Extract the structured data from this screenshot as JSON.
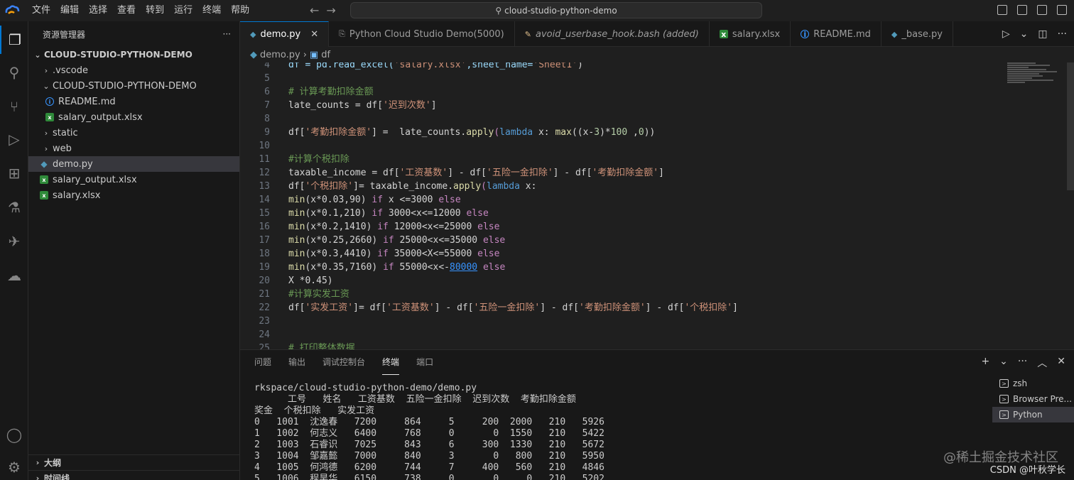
{
  "menu": [
    "文件",
    "编辑",
    "选择",
    "查看",
    "转到",
    "运行",
    "终端",
    "帮助"
  ],
  "command_center": "cloud-studio-python-demo",
  "sidebar": {
    "title": "资源管理器",
    "more": "···",
    "root": "CLOUD-STUDIO-PYTHON-DEMO",
    "items": [
      {
        "label": ".vscode"
      },
      {
        "label": "CLOUD-STUDIO-PYTHON-DEMO"
      },
      {
        "label": "README.md"
      },
      {
        "label": "salary_output.xlsx"
      },
      {
        "label": "static"
      },
      {
        "label": "web"
      },
      {
        "label": "demo.py"
      },
      {
        "label": "salary_output.xlsx"
      },
      {
        "label": "salary.xlsx"
      }
    ],
    "outline": "大纲",
    "timeline": "时间线"
  },
  "tabs": [
    {
      "label": "demo.py",
      "icon": "python-icon"
    },
    {
      "label": "Python Cloud Studio Demo(5000)",
      "icon": "browser-icon"
    },
    {
      "label": "avoid_userbase_hook.bash (added)",
      "icon": "diff-icon"
    },
    {
      "label": "salary.xlsx",
      "icon": "excel-icon"
    },
    {
      "label": "README.md",
      "icon": "info-icon"
    },
    {
      "label": "_base.py",
      "icon": "python-icon"
    }
  ],
  "breadcrumb": {
    "file": "demo.py",
    "symbol": "df"
  },
  "code": {
    "l4": {
      "n": "4",
      "a": "df = pd.read_excel(",
      "b": "'salary.xlsx'",
      "c": ",sheet_name=",
      "d": "'Sheet1'",
      "e": ")"
    },
    "l6": {
      "n": "6",
      "t": "# 计算考勤扣除金额"
    },
    "l7": {
      "n": "7",
      "a": "late_counts = df[",
      "b": "'迟到次数'",
      "c": "]"
    },
    "l8": {
      "n": "8"
    },
    "l9": {
      "n": "9",
      "a": "df[",
      "b": "'考勤扣除金额'",
      "c": "] =  late_counts.",
      "d": "apply",
      "e": "(",
      "f": "lambda",
      "g": " x: ",
      "h": "max",
      "i": "((x-",
      "j": "3",
      "k": ")*",
      "l": "100",
      "m": " ,",
      "o": "0",
      "p": "))"
    },
    "l10": {
      "n": "10"
    },
    "l11": {
      "n": "11",
      "t": "#计算个税扣除"
    },
    "l12": {
      "n": "12",
      "a": "taxable_income = df[",
      "b": "'工资基数'",
      "c": "] - df[",
      "d": "'五险一金扣除'",
      "e": "] - df[",
      "f": "'考勤扣除金额'",
      "g": "]"
    },
    "l13": {
      "n": "13",
      "a": "df[",
      "b": "'个税扣除'",
      "c": "]= taxable_income.",
      "d": "apply",
      "e": "(",
      "f": "lambda",
      "g": " x:"
    },
    "l14": {
      "n": "14",
      "a": "min",
      "b": "(x*0.03,90) ",
      "c": "if",
      "d": " x <=3000 ",
      "e": "else"
    },
    "l15": {
      "n": "15",
      "a": "min",
      "b": "(x*0.1,210) ",
      "c": "if",
      "d": " 3000<x<=12000 ",
      "e": "else"
    },
    "l16": {
      "n": "16",
      "a": "min",
      "b": "(x*0.2,1410) ",
      "c": "if",
      "d": " 12000<x<=25000 ",
      "e": "else"
    },
    "l17": {
      "n": "17",
      "a": "min",
      "b": "(x*0.25,2660) ",
      "c": "if",
      "d": " 25000<x<=35000 ",
      "e": "else"
    },
    "l18": {
      "n": "18",
      "a": "min",
      "b": "(x*0.3,4410) ",
      "c": "if",
      "d": " 35000<X<=55000 ",
      "e": "else"
    },
    "l19": {
      "n": "19",
      "a": "min",
      "b": "(x*0.35,7160) ",
      "c": "if",
      "d": " 55000<x<-",
      "f": "80000",
      "e": " else"
    },
    "l20": {
      "n": "20",
      "t": "X *0.45)"
    },
    "l21": {
      "n": "21",
      "t": "#计算实发工资"
    },
    "l22": {
      "n": "22",
      "a": "df[",
      "b": "'实发工资'",
      "c": "]= df[",
      "d": "'工资基数'",
      "e": "] - df[",
      "f": "'五险一金扣除'",
      "g": "] - df[",
      "h": "'考勤扣除金额'",
      "i": "] - df[",
      "j": "'个税扣除'",
      "k": "]"
    },
    "l23": {
      "n": "23"
    },
    "l24": {
      "n": "24"
    },
    "l25": {
      "n": "25",
      "t": "# 打印整体数据"
    }
  },
  "panel": {
    "tabs": [
      "问题",
      "输出",
      "调试控制台",
      "终端",
      "端口"
    ],
    "terminal_lines": [
      "rkspace/cloud-studio-python-demo/demo.py",
      "      工号   姓名   工资基数  五险一金扣除  迟到次数  考勤扣除金额",
      "奖金  个税扣除   实发工资",
      "0   1001  沈逸春   7200     864     5     200  2000   210   5926",
      "1   1002  何志义   6400     768     0       0  1550   210   5422",
      "2   1003  石睿识   7025     843     6     300  1330   210   5672",
      "3   1004  邹嘉懿   7000     840     3       0   800   210   5950",
      "4   1005  何鸿德   6200     744     7     400   560   210   4846",
      "5   1006  程昊华   6150     738     0       0     0   210   5202"
    ],
    "terminals": [
      "zsh",
      "Browser Pre...",
      "Python"
    ]
  },
  "watermark": "@稀土掘金技术社区",
  "watermark2": "CSDN @叶秋学长"
}
